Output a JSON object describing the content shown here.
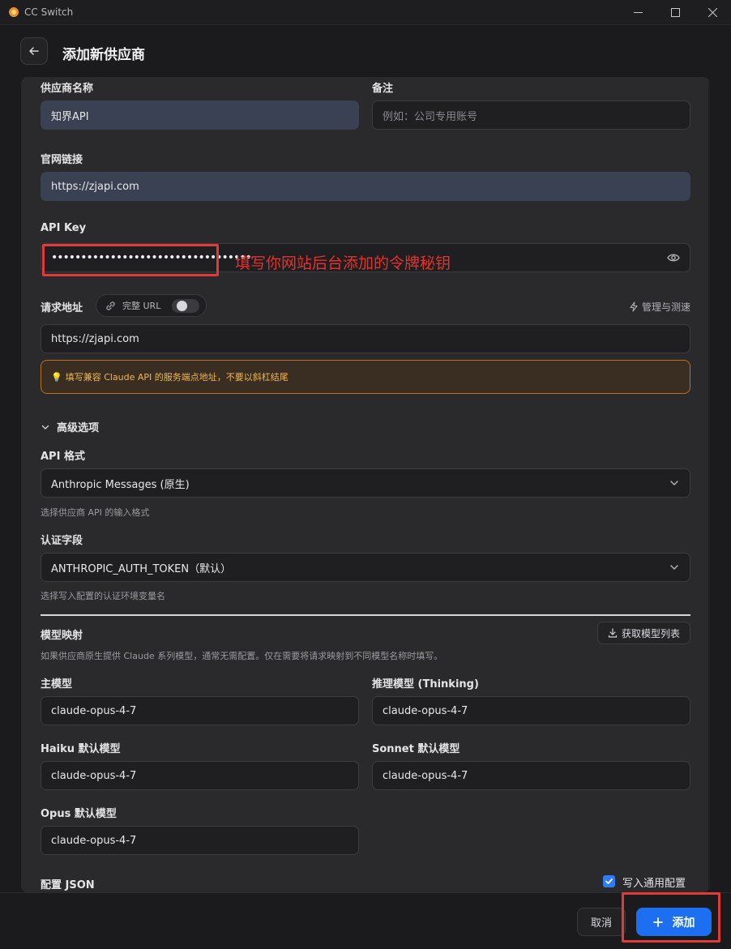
{
  "window": {
    "title": "CC Switch"
  },
  "header": {
    "title": "添加新供应商"
  },
  "form": {
    "provider_name": {
      "label": "供应商名称",
      "value": "知界API"
    },
    "notes": {
      "label": "备注",
      "placeholder": "例如：公司专用账号"
    },
    "website": {
      "label": "官网链接",
      "value": "https://zjapi.com"
    },
    "api_key": {
      "label": "API Key",
      "masked_value": "••••••••••••••••••••••••••••••••••",
      "annotation": "填写你网站后台添加的令牌秘钥"
    },
    "request_url": {
      "label": "请求地址",
      "toggle_label": "完整 URL",
      "manage_label": "管理与测速",
      "value": "https://zjapi.com",
      "warning": "填写兼容 Claude API 的服务端点地址，不要以斜杠结尾"
    },
    "advanced": {
      "label": "高级选项"
    },
    "api_format": {
      "label": "API 格式",
      "value": "Anthropic Messages (原生)",
      "hint": "选择供应商 API 的输入格式"
    },
    "auth_field": {
      "label": "认证字段",
      "value": "ANTHROPIC_AUTH_TOKEN（默认）",
      "hint": "选择写入配置的认证环境变量名"
    },
    "model_mapping": {
      "label": "模型映射",
      "fetch_label": "获取模型列表",
      "hint": "如果供应商原生提供 Claude 系列模型，通常无需配置。仅在需要将请求映射到不同模型名称时填写。",
      "main_model": {
        "label": "主模型",
        "value": "claude-opus-4-7"
      },
      "thinking_model": {
        "label": "推理模型 (Thinking)",
        "value": "claude-opus-4-7"
      },
      "haiku_model": {
        "label": "Haiku 默认模型",
        "value": "claude-opus-4-7"
      },
      "sonnet_model": {
        "label": "Sonnet 默认模型",
        "value": "claude-opus-4-7"
      },
      "opus_model": {
        "label": "Opus 默认模型",
        "value": "claude-opus-4-7"
      }
    },
    "config_json": {
      "label": "配置 JSON",
      "checkbox_label": "写入通用配置",
      "checked": true
    }
  },
  "footer": {
    "cancel_label": "取消",
    "add_label": "添加"
  },
  "colors": {
    "accent": "#1d6ff2",
    "annotation": "#e5322d",
    "warning": "#f0b650"
  }
}
